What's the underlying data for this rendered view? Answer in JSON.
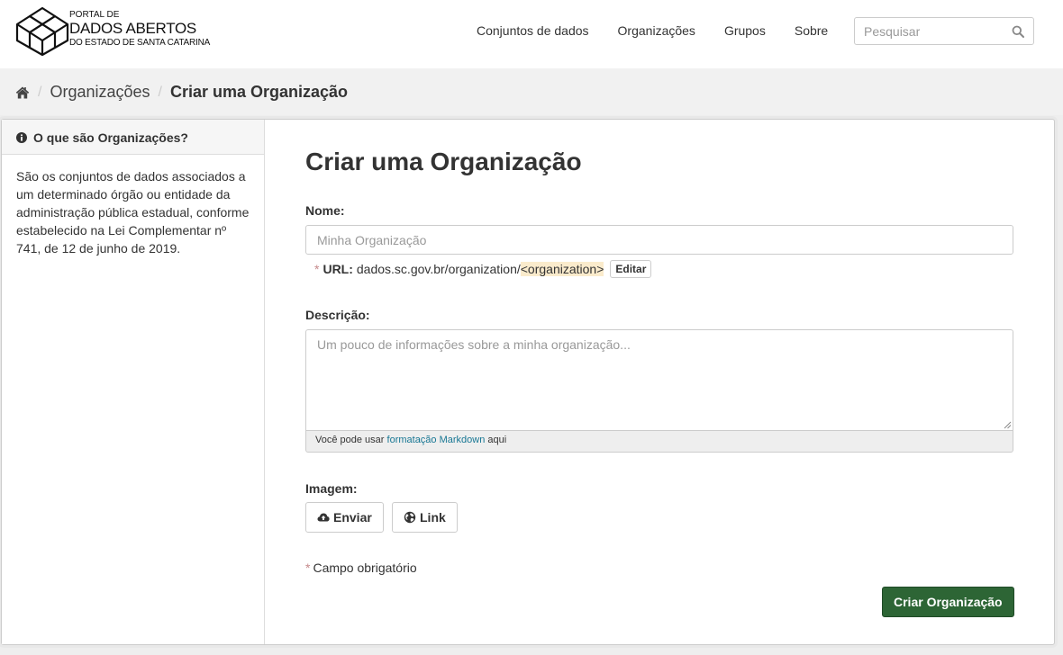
{
  "header": {
    "logo": {
      "line1": "PORTAL DE",
      "line2": "DADOS ABERTOS",
      "line3": "DO ESTADO DE SANTA CATARINA"
    },
    "nav": [
      {
        "label": "Conjuntos de dados"
      },
      {
        "label": "Organizações"
      },
      {
        "label": "Grupos"
      },
      {
        "label": "Sobre"
      }
    ],
    "search": {
      "placeholder": "Pesquisar",
      "icon": "search-icon"
    }
  },
  "breadcrumb": {
    "home_icon": "home-icon",
    "items": [
      "Organizações",
      "Criar uma Organização"
    ]
  },
  "sidebar": {
    "heading": "O que são Organizações?",
    "heading_icon": "info-circle-icon",
    "body": "São os conjuntos de dados associados a um determinado órgão ou entidade da administração pública estadual, conforme estabelecido na Lei Complementar nº 741, de 12 de junho de 2019."
  },
  "form": {
    "title": "Criar uma Organização",
    "name": {
      "label": "Nome:",
      "placeholder": "Minha Organização",
      "value": ""
    },
    "url": {
      "required_mark": "*",
      "label": "URL:",
      "prefix": "dados.sc.gov.br/organization/",
      "slug": "<organization>",
      "edit_button": "Editar"
    },
    "description": {
      "label": "Descrição:",
      "placeholder": "Um pouco de informações sobre a minha organização...",
      "value": "",
      "note_prefix": "Você pode usar ",
      "note_link": "formatação Markdown",
      "note_suffix": " aqui"
    },
    "image": {
      "label": "Imagem:",
      "upload_button": "Enviar",
      "upload_icon": "cloud-upload-icon",
      "link_button": "Link",
      "link_icon": "globe-icon"
    },
    "required_note": {
      "mark": "*",
      "text": "Campo obrigatório"
    },
    "submit_button": "Criar Organização"
  },
  "colors": {
    "primary_button": "#2d6535",
    "link": "#187794",
    "required": "#c6898b",
    "slug_highlight": "#faebcc"
  }
}
